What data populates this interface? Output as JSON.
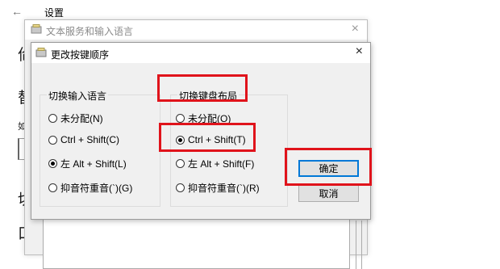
{
  "settings_window": {
    "back_arrow": "←",
    "title": "设置",
    "glyphs": [
      "佡",
      "替",
      "如",
      "切",
      "口"
    ]
  },
  "text_services_dialog": {
    "title": "文本服务和输入语言",
    "close": "×"
  },
  "key_sequence_dialog": {
    "title": "更改按键顺序",
    "close": "×",
    "input_language_group": {
      "title": "切换输入语言",
      "options": [
        "未分配(N)",
        "Ctrl + Shift(C)",
        "左 Alt + Shift(L)",
        "抑音符重音(`)(G)"
      ],
      "selected_index": 2
    },
    "keyboard_layout_group": {
      "title": "切换键盘布局",
      "options": [
        "未分配(O)",
        "Ctrl + Shift(T)",
        "左 Alt + Shift(F)",
        "抑音符重音(`)(R)"
      ],
      "selected_index": 1
    },
    "ok_button": "确定",
    "cancel_button": "取消"
  },
  "highlight_color": "#e0131b"
}
